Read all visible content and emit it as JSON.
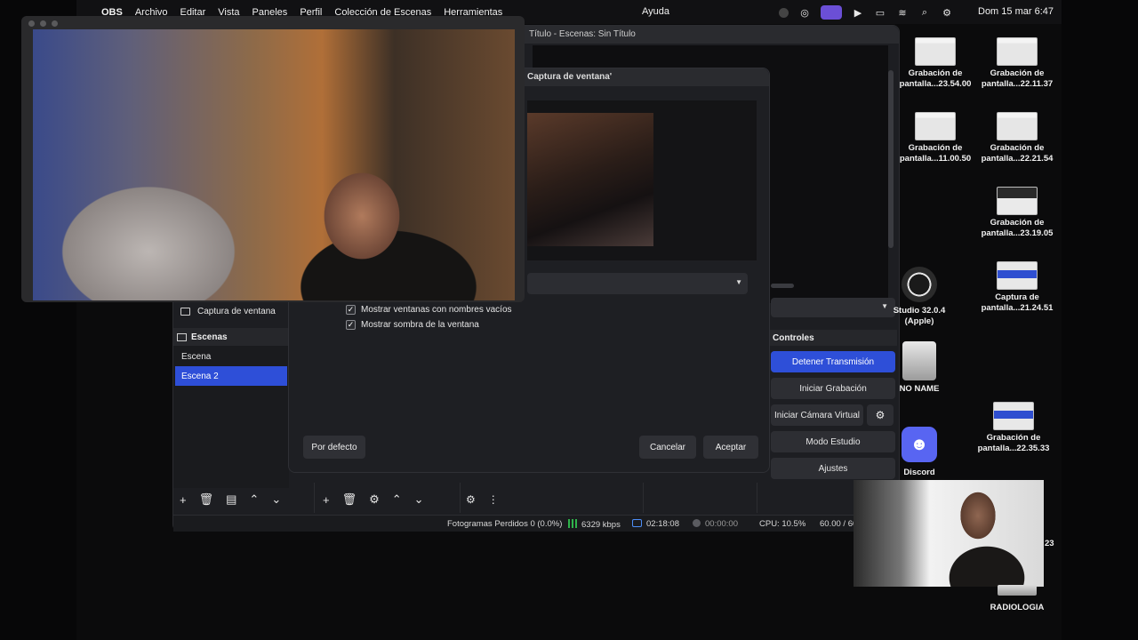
{
  "menubar": {
    "app": "OBS",
    "items": [
      "Archivo",
      "Editar",
      "Vista",
      "Paneles",
      "Perfil",
      "Colección de Escenas",
      "Herramientas"
    ],
    "help": "Ayuda",
    "clock": "Dom 15 mar 6:47"
  },
  "obs": {
    "title": "Título - Escenas: Sin Título",
    "source_item": "Captura de ventana",
    "scenes_header": "Escenas",
    "scenes": [
      "Escena",
      "Escena 2"
    ],
    "controls_header": "Controles",
    "controls": {
      "stop_stream": "Detener Transmisión",
      "start_record": "Iniciar Grabación",
      "virtual_cam": "Iniciar Cámara Virtual",
      "studio_mode": "Modo Estudio",
      "settings": "Ajustes"
    },
    "status": {
      "dropped": "Fotogramas Perdidos 0 (0.0%)",
      "bitrate": "6329 kbps",
      "stream_time": "02:18:08",
      "record_time": "00:00:00",
      "cpu": "CPU: 10.5%",
      "fps": "60.00 / 60"
    }
  },
  "dialog": {
    "title": "Captura de ventana'",
    "check1": "Mostrar ventanas con nombres vacíos",
    "check2": "Mostrar sombra de la ventana",
    "default_btn": "Por defecto",
    "cancel_btn": "Cancelar",
    "ok_btn": "Aceptar"
  },
  "desktop": {
    "icons": [
      {
        "l1": "Grabación de",
        "l2": "pantalla...23.54.00"
      },
      {
        "l1": "Grabación de",
        "l2": "pantalla...22.11.37"
      },
      {
        "l1": "Grabación de",
        "l2": "pantalla...11.00.50"
      },
      {
        "l1": "Grabación de",
        "l2": "pantalla...22.21.54"
      },
      {
        "l1": "Grabación de",
        "l2": "pantalla...23.19.05"
      },
      {
        "l1": "Studio 32.0.4",
        "l2": "(Apple)"
      },
      {
        "l1": "Captura de",
        "l2": "pantalla...21.24.51"
      },
      {
        "l1": "NO NAME",
        "l2": ""
      },
      {
        "l1": "Grabación de",
        "l2": "pantalla...22.35.33"
      },
      {
        "l1": "Discord",
        "l2": ""
      },
      {
        "l1": "RADIOLOGIA",
        "l2": ""
      }
    ],
    "partial_label": "23"
  },
  "colors": {
    "accent": "#2e4fd8",
    "discord": "#5865f2",
    "status_active": "#6b4fd6"
  }
}
